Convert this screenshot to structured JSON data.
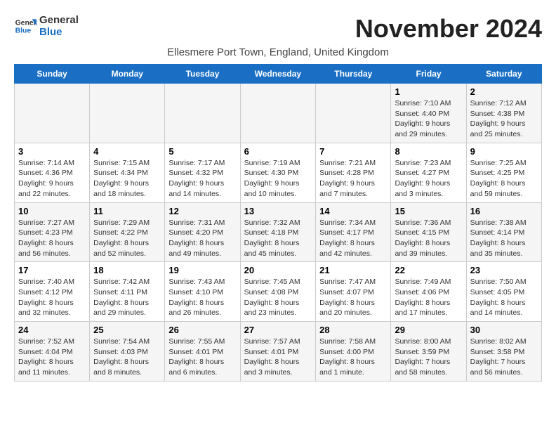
{
  "logo": {
    "line1": "General",
    "line2": "Blue"
  },
  "title": "November 2024",
  "subtitle": "Ellesmere Port Town, England, United Kingdom",
  "weekdays": [
    "Sunday",
    "Monday",
    "Tuesday",
    "Wednesday",
    "Thursday",
    "Friday",
    "Saturday"
  ],
  "weeks": [
    [
      {
        "day": "",
        "info": ""
      },
      {
        "day": "",
        "info": ""
      },
      {
        "day": "",
        "info": ""
      },
      {
        "day": "",
        "info": ""
      },
      {
        "day": "",
        "info": ""
      },
      {
        "day": "1",
        "info": "Sunrise: 7:10 AM\nSunset: 4:40 PM\nDaylight: 9 hours and 29 minutes."
      },
      {
        "day": "2",
        "info": "Sunrise: 7:12 AM\nSunset: 4:38 PM\nDaylight: 9 hours and 25 minutes."
      }
    ],
    [
      {
        "day": "3",
        "info": "Sunrise: 7:14 AM\nSunset: 4:36 PM\nDaylight: 9 hours and 22 minutes."
      },
      {
        "day": "4",
        "info": "Sunrise: 7:15 AM\nSunset: 4:34 PM\nDaylight: 9 hours and 18 minutes."
      },
      {
        "day": "5",
        "info": "Sunrise: 7:17 AM\nSunset: 4:32 PM\nDaylight: 9 hours and 14 minutes."
      },
      {
        "day": "6",
        "info": "Sunrise: 7:19 AM\nSunset: 4:30 PM\nDaylight: 9 hours and 10 minutes."
      },
      {
        "day": "7",
        "info": "Sunrise: 7:21 AM\nSunset: 4:28 PM\nDaylight: 9 hours and 7 minutes."
      },
      {
        "day": "8",
        "info": "Sunrise: 7:23 AM\nSunset: 4:27 PM\nDaylight: 9 hours and 3 minutes."
      },
      {
        "day": "9",
        "info": "Sunrise: 7:25 AM\nSunset: 4:25 PM\nDaylight: 8 hours and 59 minutes."
      }
    ],
    [
      {
        "day": "10",
        "info": "Sunrise: 7:27 AM\nSunset: 4:23 PM\nDaylight: 8 hours and 56 minutes."
      },
      {
        "day": "11",
        "info": "Sunrise: 7:29 AM\nSunset: 4:22 PM\nDaylight: 8 hours and 52 minutes."
      },
      {
        "day": "12",
        "info": "Sunrise: 7:31 AM\nSunset: 4:20 PM\nDaylight: 8 hours and 49 minutes."
      },
      {
        "day": "13",
        "info": "Sunrise: 7:32 AM\nSunset: 4:18 PM\nDaylight: 8 hours and 45 minutes."
      },
      {
        "day": "14",
        "info": "Sunrise: 7:34 AM\nSunset: 4:17 PM\nDaylight: 8 hours and 42 minutes."
      },
      {
        "day": "15",
        "info": "Sunrise: 7:36 AM\nSunset: 4:15 PM\nDaylight: 8 hours and 39 minutes."
      },
      {
        "day": "16",
        "info": "Sunrise: 7:38 AM\nSunset: 4:14 PM\nDaylight: 8 hours and 35 minutes."
      }
    ],
    [
      {
        "day": "17",
        "info": "Sunrise: 7:40 AM\nSunset: 4:12 PM\nDaylight: 8 hours and 32 minutes."
      },
      {
        "day": "18",
        "info": "Sunrise: 7:42 AM\nSunset: 4:11 PM\nDaylight: 8 hours and 29 minutes."
      },
      {
        "day": "19",
        "info": "Sunrise: 7:43 AM\nSunset: 4:10 PM\nDaylight: 8 hours and 26 minutes."
      },
      {
        "day": "20",
        "info": "Sunrise: 7:45 AM\nSunset: 4:08 PM\nDaylight: 8 hours and 23 minutes."
      },
      {
        "day": "21",
        "info": "Sunrise: 7:47 AM\nSunset: 4:07 PM\nDaylight: 8 hours and 20 minutes."
      },
      {
        "day": "22",
        "info": "Sunrise: 7:49 AM\nSunset: 4:06 PM\nDaylight: 8 hours and 17 minutes."
      },
      {
        "day": "23",
        "info": "Sunrise: 7:50 AM\nSunset: 4:05 PM\nDaylight: 8 hours and 14 minutes."
      }
    ],
    [
      {
        "day": "24",
        "info": "Sunrise: 7:52 AM\nSunset: 4:04 PM\nDaylight: 8 hours and 11 minutes."
      },
      {
        "day": "25",
        "info": "Sunrise: 7:54 AM\nSunset: 4:03 PM\nDaylight: 8 hours and 8 minutes."
      },
      {
        "day": "26",
        "info": "Sunrise: 7:55 AM\nSunset: 4:01 PM\nDaylight: 8 hours and 6 minutes."
      },
      {
        "day": "27",
        "info": "Sunrise: 7:57 AM\nSunset: 4:01 PM\nDaylight: 8 hours and 3 minutes."
      },
      {
        "day": "28",
        "info": "Sunrise: 7:58 AM\nSunset: 4:00 PM\nDaylight: 8 hours and 1 minute."
      },
      {
        "day": "29",
        "info": "Sunrise: 8:00 AM\nSunset: 3:59 PM\nDaylight: 7 hours and 58 minutes."
      },
      {
        "day": "30",
        "info": "Sunrise: 8:02 AM\nSunset: 3:58 PM\nDaylight: 7 hours and 56 minutes."
      }
    ]
  ]
}
